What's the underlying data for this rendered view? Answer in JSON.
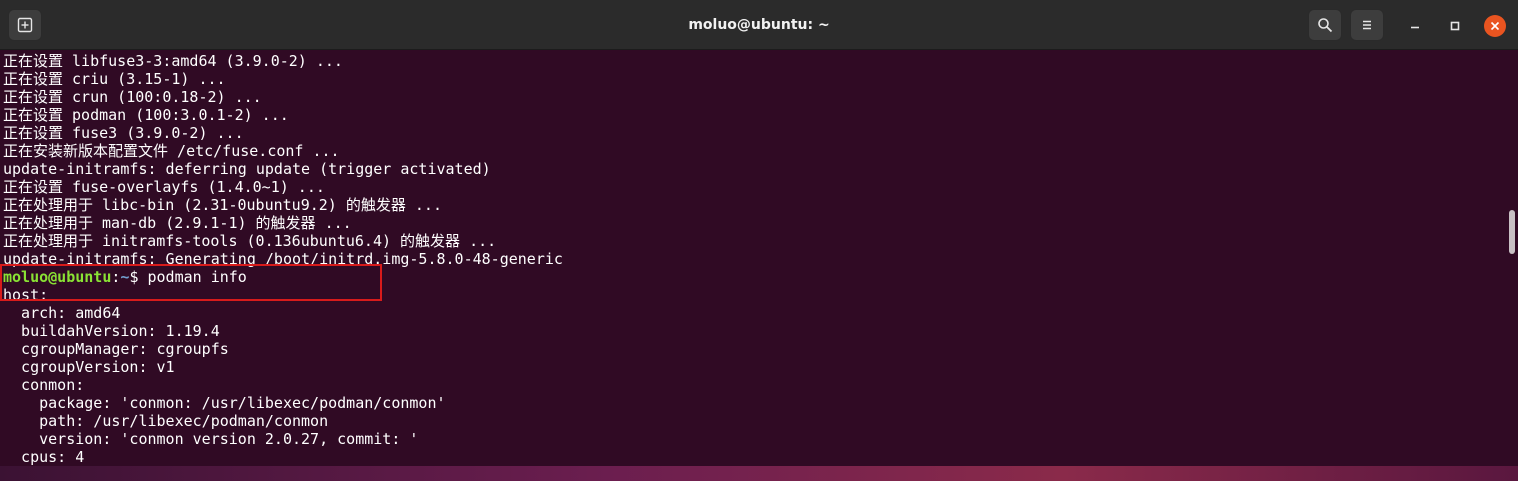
{
  "window": {
    "title": "moluo@ubuntu: ~"
  },
  "colors": {
    "terminal_bg": "#300a24",
    "titlebar_bg": "#2b2b2b",
    "prompt_user": "#8ae234",
    "prompt_path": "#729fcf",
    "close_button": "#e95420",
    "highlight_box": "#d81b1b"
  },
  "icons": {
    "new_tab": "new-tab-icon",
    "search": "search-icon",
    "menu": "hamburger-icon",
    "minimize": "minimize-icon",
    "maximize": "maximize-icon",
    "close": "close-icon"
  },
  "terminal": {
    "lines_before": [
      "正在设置 libfuse3-3:amd64 (3.9.0-2) ...",
      "正在设置 criu (3.15-1) ...",
      "正在设置 crun (100:0.18-2) ...",
      "正在设置 podman (100:3.0.1-2) ...",
      "正在设置 fuse3 (3.9.0-2) ...",
      "正在安装新版本配置文件 /etc/fuse.conf ...",
      "update-initramfs: deferring update (trigger activated)",
      "正在设置 fuse-overlayfs (1.4.0~1) ...",
      "正在处理用于 libc-bin (2.31-0ubuntu9.2) 的触发器 ...",
      "正在处理用于 man-db (2.9.1-1) 的触发器 ...",
      "正在处理用于 initramfs-tools (0.136ubuntu6.4) 的触发器 ...",
      "update-initramfs: Generating /boot/initrd.img-5.8.0-48-generic"
    ],
    "prompt": {
      "user_host": "moluo@ubuntu",
      "colon": ":",
      "path": "~",
      "symbol": "$ ",
      "command": "podman info"
    },
    "lines_after": [
      "host:",
      "  arch: amd64",
      "  buildahVersion: 1.19.4",
      "  cgroupManager: cgroupfs",
      "  cgroupVersion: v1",
      "  conmon:",
      "    package: 'conmon: /usr/libexec/podman/conmon'",
      "    path: /usr/libexec/podman/conmon",
      "    version: 'conmon version 2.0.27, commit: '",
      "  cpus: 4"
    ]
  }
}
